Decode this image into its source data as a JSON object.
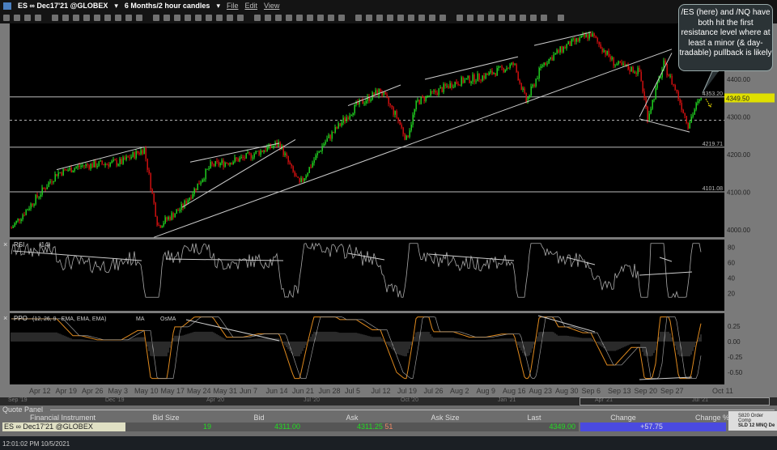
{
  "menubar": {
    "symbol": "ES ∞ Dec17'21 @GLOBEX",
    "timeframe": "6 Months/2 hour candles",
    "menus": [
      "File",
      "Edit",
      "View"
    ]
  },
  "price_axis": {
    "labels": [
      "4400.00",
      "4300.00",
      "4200.00",
      "4100.00",
      "4000.00"
    ],
    "current": "4349.50",
    "levels": [
      "4353.20",
      "4219.71",
      "4101.08"
    ]
  },
  "rsi": {
    "label": "RSI",
    "params": "(14)",
    "axis": [
      "80",
      "60",
      "40",
      "20"
    ]
  },
  "ppo": {
    "label": "PPO",
    "params": "(12, 26, 9 - EMA, EMA, EMA)",
    "ma": "MA",
    "osma": "OsMA",
    "axis": [
      "0.25",
      "0.00",
      "-0.25",
      "-0.50"
    ]
  },
  "dates": [
    "Apr 12",
    "Apr 19",
    "Apr 26",
    "May 3",
    "May 10",
    "May 17",
    "May 24",
    "May 31",
    "Jun 7",
    "Jun 14",
    "Jun 21",
    "Jun 28",
    "Jul 5",
    "Jul 12",
    "Jul 19",
    "Jul 26",
    "Aug 2",
    "Aug 9",
    "Aug 16",
    "Aug 23",
    "Aug 30",
    "Sep 6",
    "Sep 13",
    "Sep 20",
    "Sep 27",
    "Oct 11"
  ],
  "scroll_dates": [
    "Sep '19",
    "Dec '19",
    "Apr '20",
    "Jul '20",
    "Oct '20",
    "Jan '21",
    "Apr '21",
    "Jul '21"
  ],
  "quote_panel": {
    "title": "Quote Panel",
    "headers": [
      "Financial Instrument",
      "Bid Size",
      "Bid",
      "Ask",
      "Ask Size",
      "Last",
      "Change",
      "Change %"
    ],
    "row": {
      "instrument": "ES ∞ Dec17'21 @GLOBEX",
      "bid_size": "19",
      "bid": "4311.00",
      "ask": "4311.25",
      "ask_size": "51",
      "last": "4349.00",
      "change": "+57.75"
    }
  },
  "popup": {
    "line1": "S820 Order Comp",
    "line2": "SLD 12 MNQ De"
  },
  "status": {
    "timestamp": "12:01:02 PM 10/5/2021"
  },
  "callout": {
    "text": "/ES (here) and /NQ have both hit the first resistance level where at least a minor (& day-tradable) pullback is likely"
  },
  "colors": {
    "up": "#22dd22",
    "down": "#dd1111",
    "ppo": "#e08a1e",
    "change_bg": "#4a4ae0",
    "callout_arrow": "#e6d600"
  }
}
